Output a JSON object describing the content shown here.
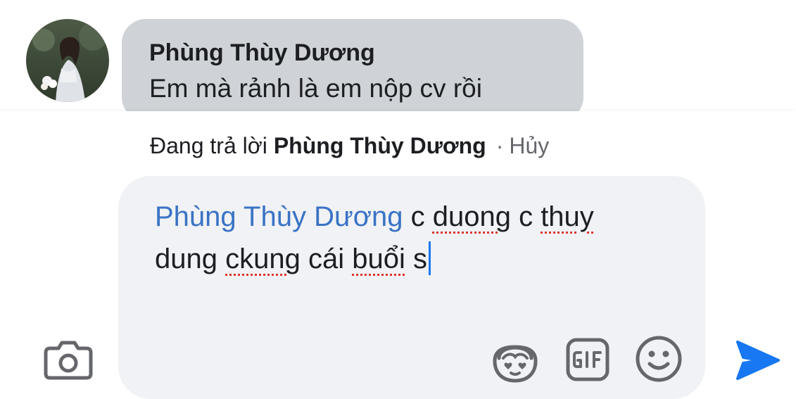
{
  "comment": {
    "author": "Phùng Thùy Dương",
    "text": "Em mà rảnh là em nộp cv rồi",
    "avatar_icon": "profile-photo"
  },
  "reply_bar": {
    "prefix": "Đang trả lời",
    "name": "Phùng Thùy Dương",
    "separator": "·",
    "cancel": "Hủy"
  },
  "composer": {
    "mention": "Phùng Thùy Dương",
    "segments": [
      " c ",
      "duong",
      " c ",
      "thuy",
      " dung ",
      "ckung",
      " cái ",
      "buổi",
      " s"
    ]
  },
  "toolbar": {
    "camera_icon": "camera-icon",
    "avatar_sticker_icon": "avatar-sticker-icon",
    "gif_icon": "gif-icon",
    "emoji_icon": "smiley-icon",
    "send_icon": "send-icon"
  },
  "colors": {
    "bubble": "#cfd3d7",
    "composer_bg": "#f0f2f5",
    "mention": "#3a73c5",
    "send": "#1877f2",
    "icon_gray": "#65676b"
  }
}
